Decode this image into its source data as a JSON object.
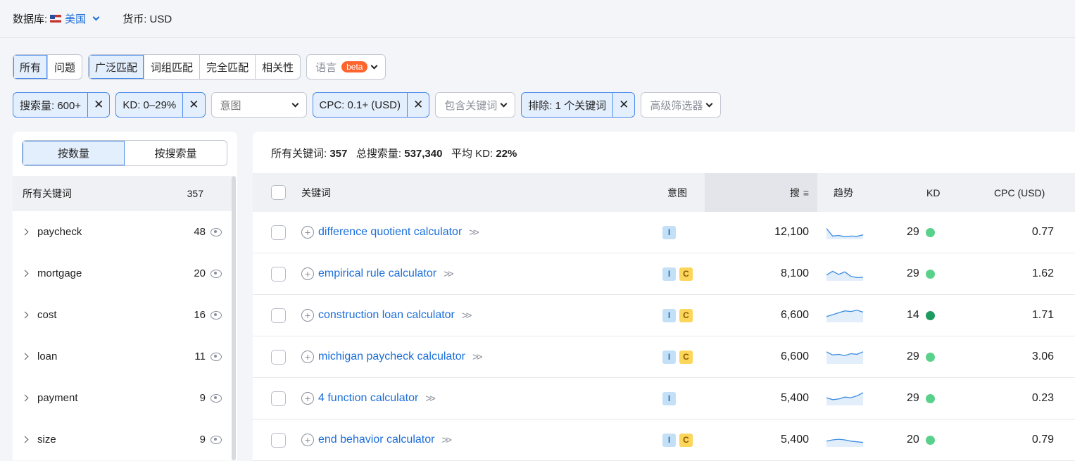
{
  "topbar": {
    "db_label": "数据库:",
    "db_value": "美国",
    "currency": "货币: USD"
  },
  "filters_row1": {
    "type_tabs": [
      {
        "label": "所有",
        "active": true
      },
      {
        "label": "问题",
        "active": false
      }
    ],
    "match_tabs": [
      {
        "label": "广泛匹配",
        "active": true
      },
      {
        "label": "词组匹配",
        "active": false
      },
      {
        "label": "完全匹配",
        "active": false
      },
      {
        "label": "相关性",
        "active": false
      }
    ],
    "language": {
      "label": "语言",
      "badge": "beta"
    }
  },
  "filters_row2": {
    "volume": "搜索量: 600+",
    "kd": "KD: 0–29%",
    "intent": "意图",
    "cpc": "CPC: 0.1+ (USD)",
    "include": "包含关键词",
    "exclude": "排除: 1 个关键词",
    "advanced": "高级筛选器"
  },
  "sidebar": {
    "toggle": [
      {
        "label": "按数量",
        "active": true
      },
      {
        "label": "按搜索量",
        "active": false
      }
    ],
    "header": {
      "label": "所有关键词",
      "count": "357"
    },
    "items": [
      {
        "label": "paycheck",
        "count": "48"
      },
      {
        "label": "mortgage",
        "count": "20"
      },
      {
        "label": "cost",
        "count": "16"
      },
      {
        "label": "loan",
        "count": "11"
      },
      {
        "label": "payment",
        "count": "9"
      },
      {
        "label": "size",
        "count": "9"
      }
    ]
  },
  "summary": {
    "all_label": "所有关键词:",
    "all_value": "357",
    "vol_label": "总搜索量:",
    "vol_value": "537,340",
    "kd_label": "平均 KD:",
    "kd_value": "22%"
  },
  "table": {
    "headers": {
      "keyword": "关键词",
      "intent": "意图",
      "volume": "搜",
      "trend": "趋势",
      "kd": "KD",
      "cpc": "CPC (USD)"
    },
    "rows": [
      {
        "keyword": "difference quotient calculator",
        "intents": [
          "I"
        ],
        "volume": "12,100",
        "kd": "29",
        "kd_color": "#59d18a",
        "cpc": "0.77",
        "trend": [
          0.2,
          0.8,
          0.75,
          0.85,
          0.8,
          0.82,
          0.7
        ]
      },
      {
        "keyword": "empirical rule calculator",
        "intents": [
          "I",
          "C"
        ],
        "volume": "8,100",
        "kd": "29",
        "kd_color": "#59d18a",
        "cpc": "1.62",
        "trend": [
          0.6,
          0.3,
          0.55,
          0.35,
          0.7,
          0.8,
          0.78
        ]
      },
      {
        "keyword": "construction loan calculator",
        "intents": [
          "I",
          "C"
        ],
        "volume": "6,600",
        "kd": "14",
        "kd_color": "#1e9b60",
        "cpc": "1.71",
        "trend": [
          0.6,
          0.45,
          0.3,
          0.15,
          0.2,
          0.1,
          0.25
        ]
      },
      {
        "keyword": "michigan paycheck calculator",
        "intents": [
          "I",
          "C"
        ],
        "volume": "6,600",
        "kd": "29",
        "kd_color": "#59d18a",
        "cpc": "3.06",
        "trend": [
          0.1,
          0.35,
          0.3,
          0.4,
          0.25,
          0.3,
          0.1
        ]
      },
      {
        "keyword": "4 function calculator",
        "intents": [
          "I"
        ],
        "volume": "5,400",
        "kd": "29",
        "kd_color": "#59d18a",
        "cpc": "0.23",
        "trend": [
          0.45,
          0.6,
          0.55,
          0.4,
          0.45,
          0.3,
          0.05
        ]
      },
      {
        "keyword": "end behavior calculator",
        "intents": [
          "I",
          "C"
        ],
        "volume": "5,400",
        "kd": "20",
        "kd_color": "#59d18a",
        "cpc": "0.79",
        "trend": [
          0.6,
          0.5,
          0.45,
          0.5,
          0.6,
          0.65,
          0.7
        ]
      }
    ]
  }
}
